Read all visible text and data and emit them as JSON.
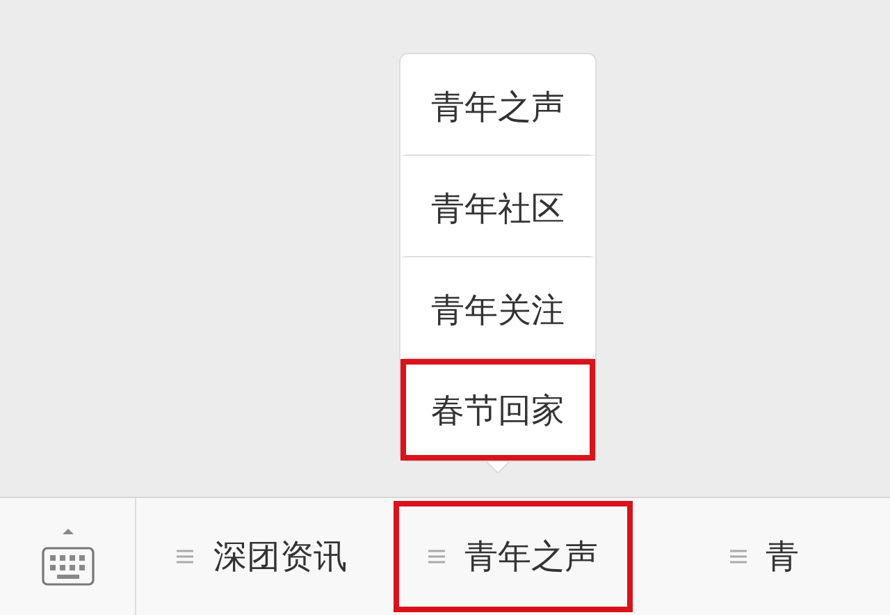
{
  "popup_menu": {
    "items": [
      {
        "label": "青年之声",
        "highlighted": false
      },
      {
        "label": "青年社区",
        "highlighted": false
      },
      {
        "label": "青年关注",
        "highlighted": false
      },
      {
        "label": "春节回家",
        "highlighted": true
      }
    ]
  },
  "menu_bar": {
    "items": [
      {
        "label": "深团资讯",
        "highlighted": false
      },
      {
        "label": "青年之声",
        "highlighted": true
      },
      {
        "label": "青",
        "highlighted": false
      }
    ]
  }
}
